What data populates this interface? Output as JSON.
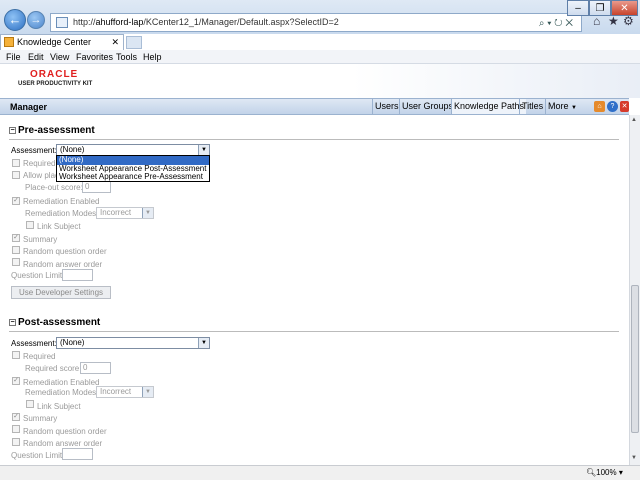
{
  "browser": {
    "back_glyph": "←",
    "forward_glyph": "→",
    "address_prefix": "http://",
    "address_host": "ahufford-lap",
    "address_path": "/KCenter12_1/Manager/Default.aspx?SelectID=2",
    "address_icons": "⌕ ▾ ↻ ✕",
    "toolbar_icons": {
      "home": "⌂",
      "favorites": "★",
      "tools": "⚙"
    },
    "window_controls": {
      "minimize": "–",
      "maximize": "❐",
      "close": "✕"
    },
    "tab_title": "Knowledge Center",
    "tab_close": "✕"
  },
  "menu": [
    "File",
    "Edit",
    "View",
    "Favorites",
    "Tools",
    "Help"
  ],
  "banner": {
    "logo": "ORACLE",
    "product": "USER PRODUCTIVITY KIT"
  },
  "manager": {
    "title": "Manager",
    "nav": [
      "Users",
      "User Groups",
      "Knowledge Paths",
      "Titles",
      "More"
    ],
    "more_arrow": "▼",
    "icons": [
      "home-icon",
      "help-icon",
      "exit-icon"
    ],
    "icon_glyphs": [
      "⌂",
      "?",
      "✕"
    ]
  },
  "pre": {
    "heading": "Pre-assessment",
    "toggle": "−",
    "assessment_label": "Assessment:",
    "assessment_value": "(None)",
    "options": [
      "(None)",
      "Worksheet Appearance Post-Assessment",
      "Worksheet Appearance Pre-Assessment"
    ],
    "required_label": "Required",
    "allow_label": "Allow plac",
    "place_out_label": "Place-out score:",
    "place_out_value": "0",
    "remediation_label": "Remediation Enabled",
    "remediation_modes_label": "Remediation Modes:",
    "remediation_modes_value": "Incorrect",
    "link_subject_label": "Link Subject",
    "summary_label": "Summary",
    "random_q_label": "Random question order",
    "random_a_label": "Random answer order",
    "question_limit_label": "Question Limit:",
    "dev_button": "Use Developer Settings"
  },
  "post": {
    "heading": "Post-assessment",
    "toggle": "−",
    "assessment_label": "Assessment:",
    "assessment_value": "(None)",
    "required_label": "Required",
    "required_score_label": "Required score:",
    "required_score_value": "0",
    "remediation_label": "Remediation Enabled",
    "remediation_modes_label": "Remediation Modes:",
    "remediation_modes_value": "Incorrect",
    "link_subject_label": "Link Subject",
    "summary_label": "Summary",
    "random_q_label": "Random question order",
    "random_a_label": "Random answer order",
    "question_limit_label": "Question Limit:"
  },
  "checks": {
    "checked": "✓",
    "arrow": "▼"
  },
  "status": {
    "zoom": "100%",
    "zoom_icon": "🔍︎",
    "zoom_arrow": "▾"
  }
}
